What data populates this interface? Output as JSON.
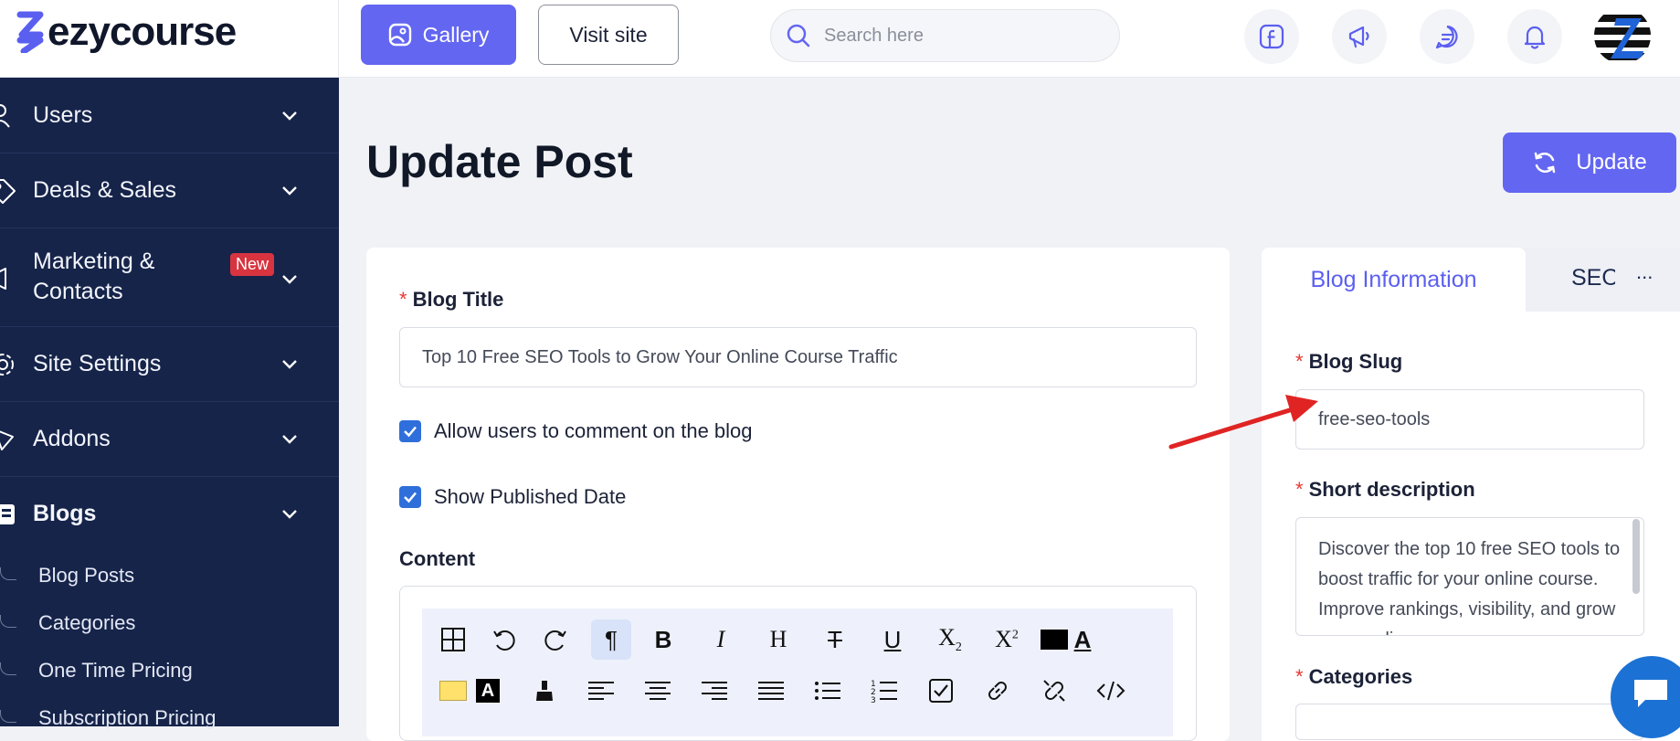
{
  "brand": {
    "name": "ezycourse",
    "accent": "#6366f1"
  },
  "topbar": {
    "gallery_label": "Gallery",
    "visit_label": "Visit site",
    "search_placeholder": "Search here",
    "icons": [
      "facebook-icon",
      "megaphone-icon",
      "chat-icon",
      "bell-icon"
    ]
  },
  "sidebar": {
    "items": [
      {
        "label": "Users",
        "icon": "users-icon"
      },
      {
        "label": "Deals & Sales",
        "icon": "tag-icon"
      },
      {
        "label": "Marketing & Contacts",
        "icon": "megaphone-icon",
        "badge": "New"
      },
      {
        "label": "Site Settings",
        "icon": "gear-icon"
      },
      {
        "label": "Addons",
        "icon": "plug-icon"
      },
      {
        "label": "Blogs",
        "icon": "blog-icon"
      }
    ],
    "blog_subitems": [
      "Blog Posts",
      "Categories",
      "One Time Pricing",
      "Subscription Pricing"
    ]
  },
  "main": {
    "title": "Update Post",
    "update_label": "Update",
    "blog_title_label": "Blog Title",
    "blog_title_value": "Top 10 Free SEO Tools to Grow Your Online Course Traffic",
    "allow_comments_label": "Allow users to comment on the blog",
    "allow_comments_checked": true,
    "show_date_label": "Show Published Date",
    "show_date_checked": true,
    "content_label": "Content"
  },
  "right_panel": {
    "tabs": [
      "Blog Information",
      "SEO"
    ],
    "more": "...",
    "slug_label": "Blog Slug",
    "slug_value": "free-seo-tools",
    "short_desc_label": "Short description",
    "short_desc_value": "Discover the top 10 free SEO tools to boost traffic for your online course. Improve rankings, visibility, and grow your audience.",
    "categories_label": "Categories"
  },
  "colors": {
    "sidebar_bg": "#16244a",
    "annotation_arrow": "#e02424",
    "checkbox": "#2f6fdb"
  }
}
